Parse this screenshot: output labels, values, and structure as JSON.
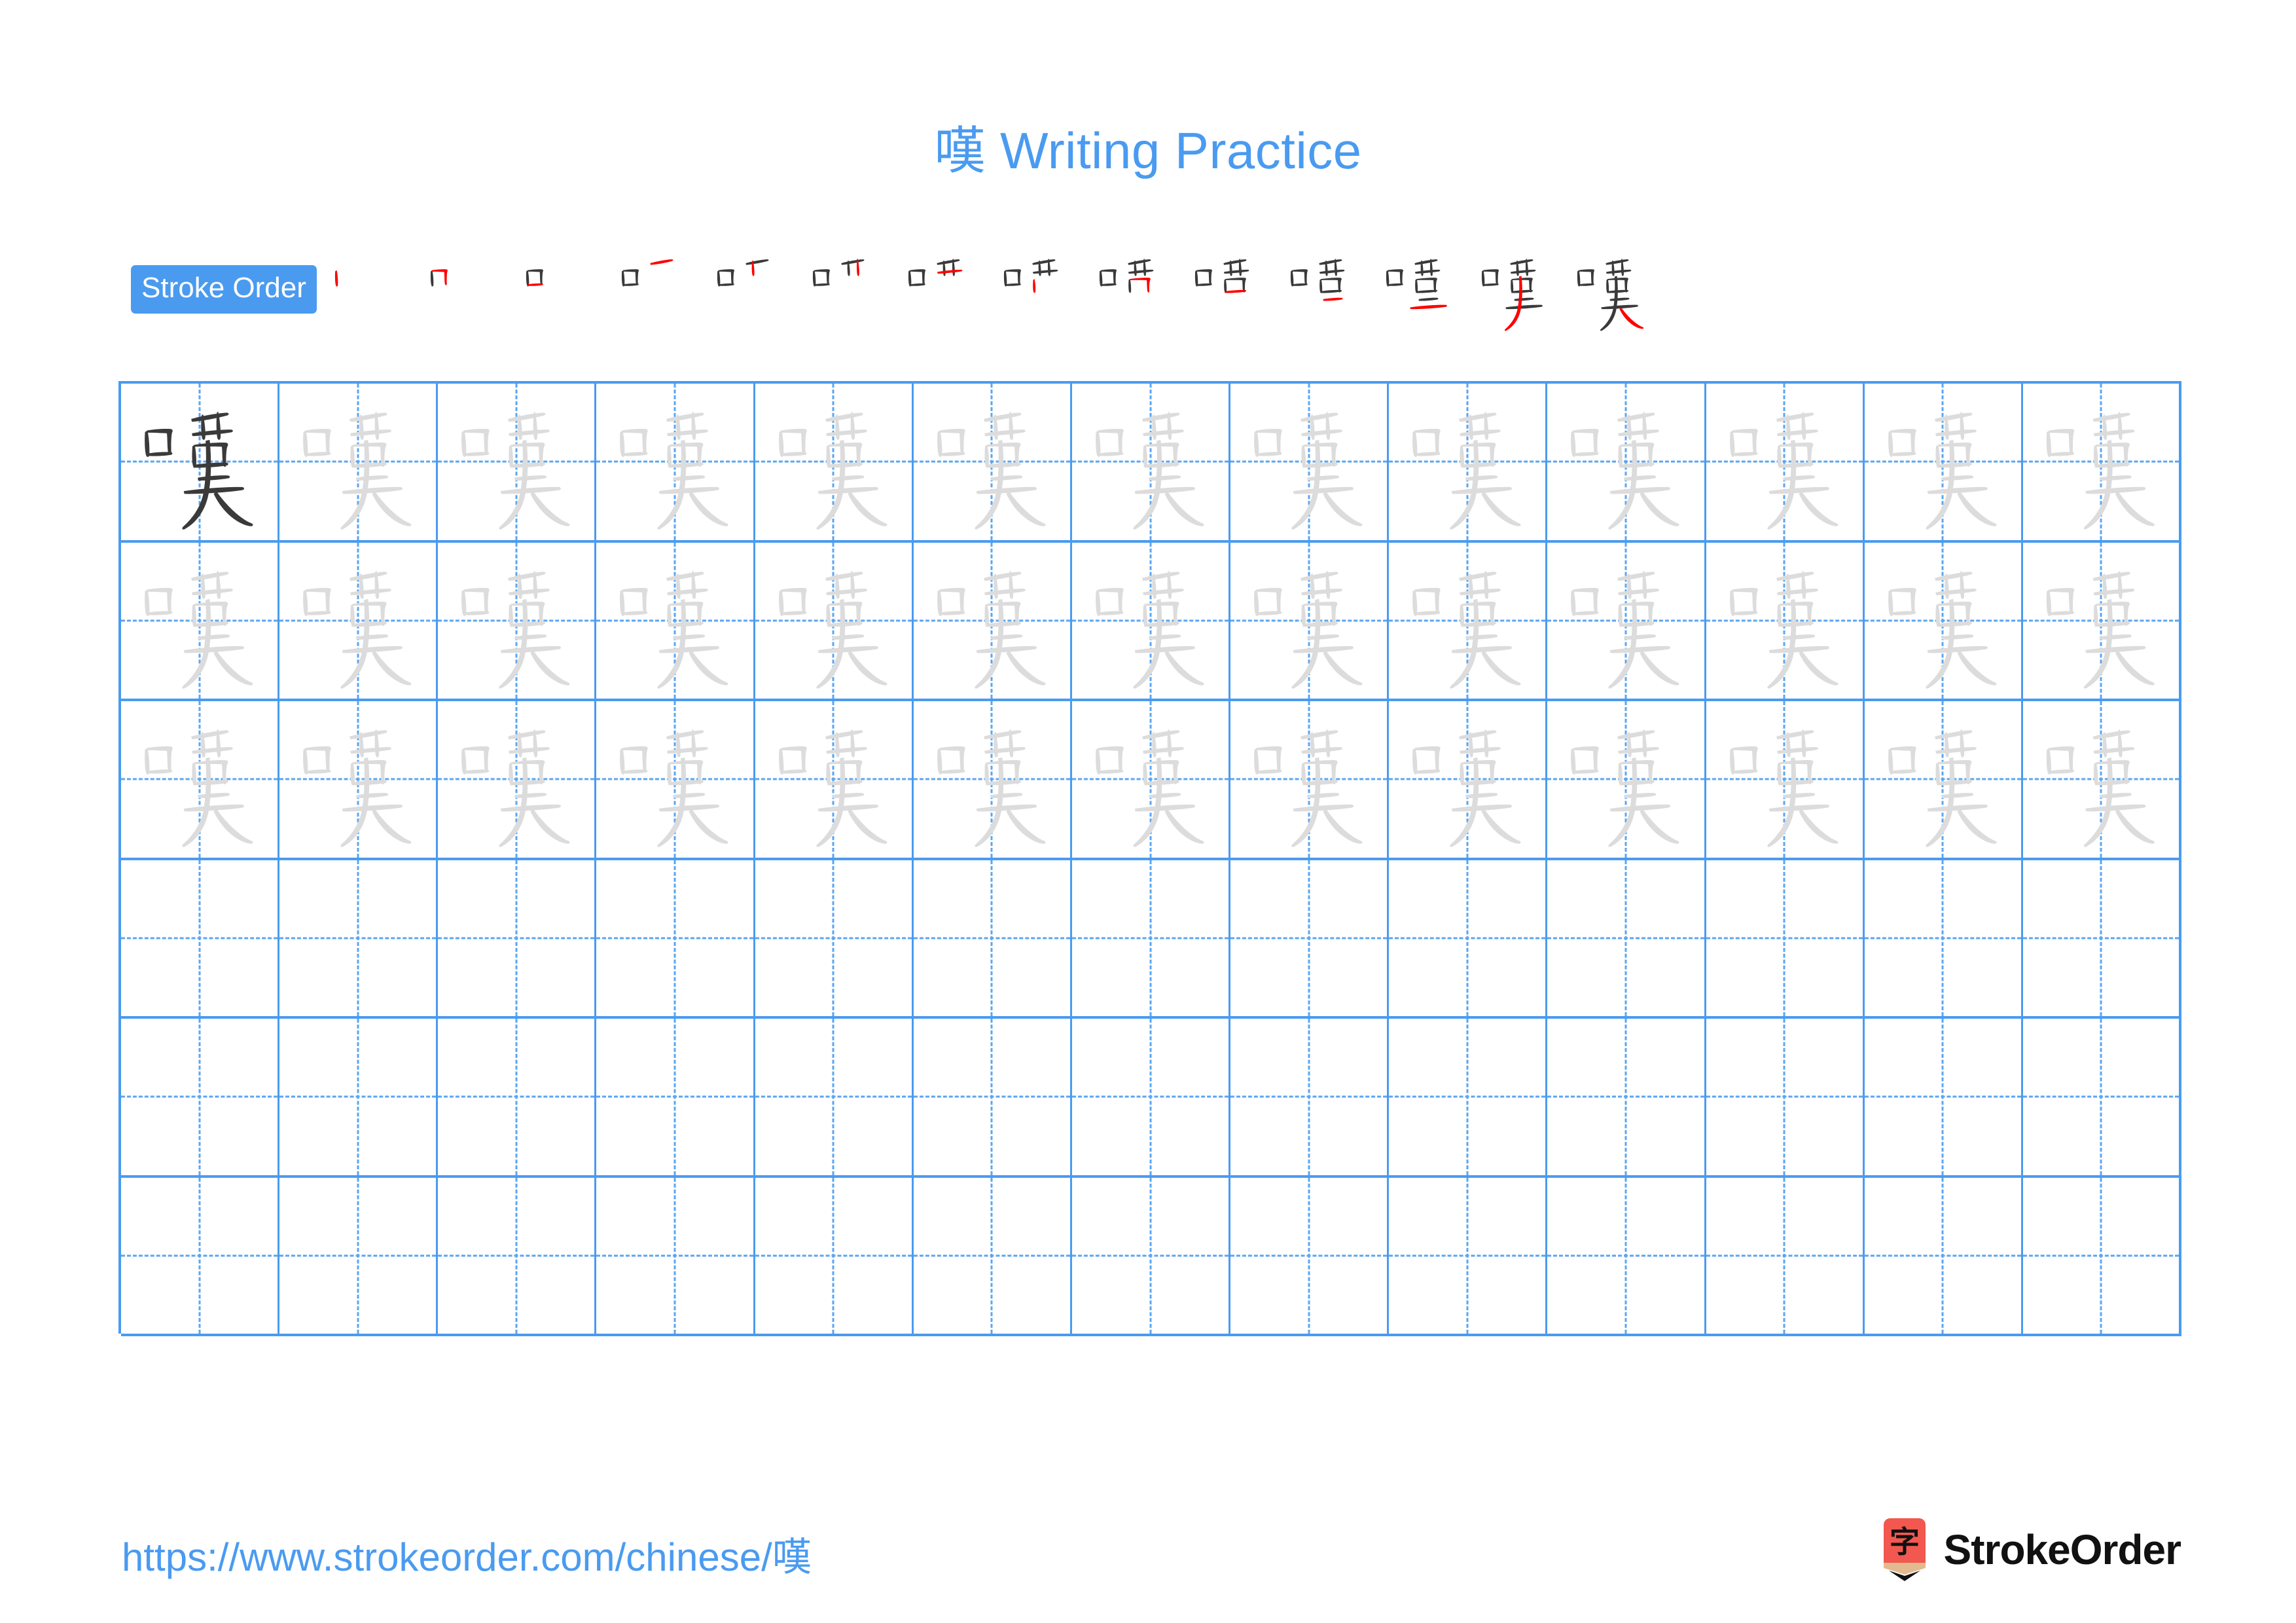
{
  "character": "嘆",
  "header": {
    "title_char": "嘆",
    "title_text": " Writing Practice",
    "full_title": "嘆 Writing Practice",
    "title_color": "#4A9BF0"
  },
  "stroke_order": {
    "badge_label": "Stroke Order",
    "badge_bg": "#4A9BF0",
    "badge_text_color": "#FFFFFF",
    "total_strokes": 14,
    "existing_stroke_color": "#3A3A3A",
    "new_stroke_color": "#FF0000",
    "steps": [
      {
        "index": 1,
        "partial": "丨",
        "new_stroke": "vertical (left side of 口)"
      },
      {
        "index": 2,
        "partial": "冂",
        "new_stroke": "horizontal-turn-vertical"
      },
      {
        "index": 3,
        "partial": "口",
        "new_stroke": "bottom horizontal (closes 口)"
      },
      {
        "index": 4,
        "partial": "口丿",
        "new_stroke": "upper horizontal of 廿"
      },
      {
        "index": 5,
        "partial": "口十",
        "new_stroke": "first vertical of 廿"
      },
      {
        "index": 6,
        "partial": "口卝",
        "new_stroke": "second vertical of 廿"
      },
      {
        "index": 7,
        "partial": "口廿",
        "new_stroke": "bottom horizontal of 廿"
      },
      {
        "index": 8,
        "partial": "唑",
        "new_stroke": "left vertical of 口 body"
      },
      {
        "index": 9,
        "partial": "哄",
        "new_stroke": "right vertical-turn"
      },
      {
        "index": 10,
        "partial": "啫",
        "new_stroke": "horizontal"
      },
      {
        "index": 11,
        "partial": "喑",
        "new_stroke": "short horizontal"
      },
      {
        "index": 12,
        "partial": "喧",
        "new_stroke": "long horizontal"
      },
      {
        "index": 13,
        "partial": "嘆",
        "new_stroke": "long left-falling (撇)"
      },
      {
        "index": 14,
        "partial": "嘆",
        "new_stroke": "right-falling (捺)"
      }
    ]
  },
  "practice_grid": {
    "columns": 13,
    "rows": 6,
    "grid_line_color": "#4A9BF0",
    "guide_line_color": "#5BA6F2",
    "model_char_color": "#3A3A3A",
    "trace_char_color": "#DCDCDC",
    "row_types": [
      "traced",
      "traced",
      "traced",
      "blank",
      "blank",
      "blank"
    ],
    "first_cell_is_model": true
  },
  "footer": {
    "url": "https://www.strokeorder.com/chinese/嘆",
    "url_color": "#4A9BF0",
    "brand_name": "StrokeOrder",
    "logo_char": "字",
    "logo_bg": "#F2584F",
    "logo_tip_color": "#E3BA8F"
  }
}
